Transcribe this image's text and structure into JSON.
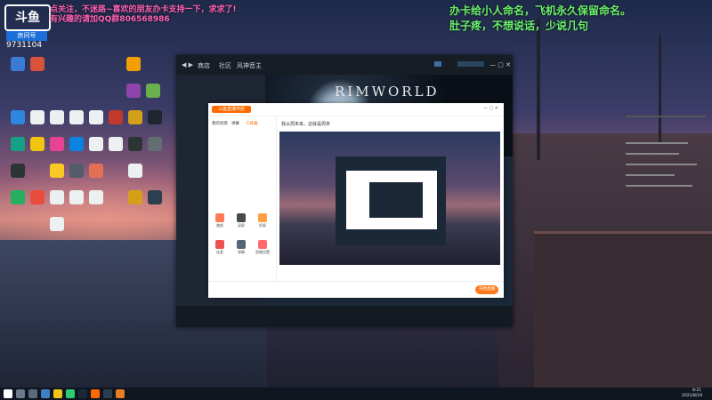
{
  "overlay": {
    "logo": "斗鱼",
    "room_label": "房间号",
    "room_number": "9731104",
    "pink_line1": "点关注，不迷路~喜欢的朋友办卡支持一下，求求了!",
    "pink_line2": "有兴趣的请加QQ群806568986",
    "green_line1": "办卡给小人命名，飞机永久保留命名。",
    "green_line2": "肚子疼，不想说话，少说几句"
  },
  "steam": {
    "nav_store": "商店",
    "nav_community": "社区",
    "nav_user": "风神音主",
    "game_title": "RIMWORLD"
  },
  "douyu": {
    "app_name": "斗鱼直播伴侣",
    "left_tabs": [
      "我的场景",
      "弹幕",
      "工具箱"
    ],
    "tools": [
      "美颜",
      "录屏",
      "投屏",
      "连麦",
      "弹幕",
      "直播设置"
    ],
    "preview_title": "我从周末来，这就是周末",
    "start_live": "开始直播"
  },
  "taskbar": {
    "time": "8:21",
    "date": "2021/8/19"
  }
}
